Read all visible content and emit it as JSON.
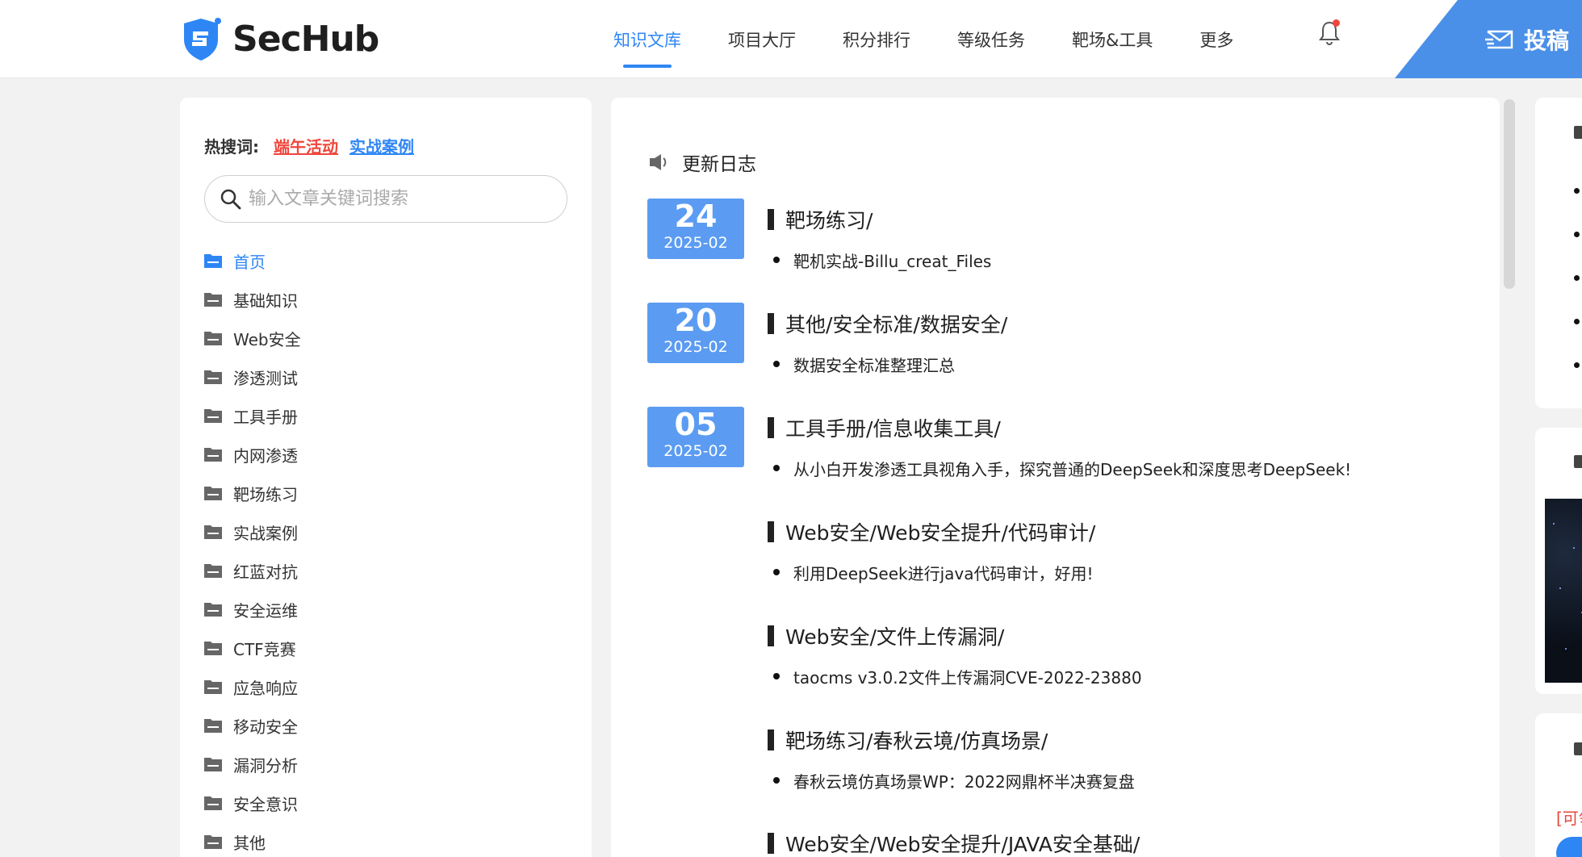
{
  "header": {
    "logo_text": "SecHub",
    "nav": [
      {
        "label": "知识文库",
        "active": true
      },
      {
        "label": "项目大厅",
        "active": false
      },
      {
        "label": "积分排行",
        "active": false
      },
      {
        "label": "等级任务",
        "active": false
      },
      {
        "label": "靶场&工具",
        "active": false
      },
      {
        "label": "更多",
        "active": false
      }
    ],
    "submit_label": "投稿"
  },
  "sidebar": {
    "hot_label": "热搜词:",
    "hot_words": [
      "端午活动",
      "实战案例"
    ],
    "search_placeholder": "输入文章关键词搜索",
    "categories": [
      {
        "label": "首页",
        "active": true
      },
      {
        "label": "基础知识"
      },
      {
        "label": "Web安全"
      },
      {
        "label": "渗透测试"
      },
      {
        "label": "工具手册"
      },
      {
        "label": "内网渗透"
      },
      {
        "label": "靶场练习"
      },
      {
        "label": "实战案例"
      },
      {
        "label": "红蓝对抗"
      },
      {
        "label": "安全运维"
      },
      {
        "label": "CTF竞赛"
      },
      {
        "label": "应急响应"
      },
      {
        "label": "移动安全"
      },
      {
        "label": "漏洞分析"
      },
      {
        "label": "安全意识"
      },
      {
        "label": "其他"
      }
    ]
  },
  "main": {
    "title": "更新日志",
    "badges": [
      {
        "day": "24",
        "ym": "2025-02"
      },
      {
        "day": "20",
        "ym": "2025-02"
      },
      {
        "day": "05",
        "ym": "2025-02"
      }
    ],
    "entries": [
      {
        "path": "靶场练习/",
        "item": "靶机实战-Billu_creat_Files"
      },
      {
        "path": "其他/安全标准/数据安全/",
        "item": "数据安全标准整理汇总"
      },
      {
        "path": "工具手册/信息收集工具/",
        "item": "从小白开发渗透工具视角入手，探究普通的DeepSeek和深度思考DeepSeek!"
      },
      {
        "path": "Web安全/Web安全提升/代码审计/",
        "item": "利用DeepSeek进行java代码审计，好用!"
      },
      {
        "path": "Web安全/文件上传漏洞/",
        "item": "taocms v3.0.2文件上传漏洞CVE-2022-23880"
      },
      {
        "path": "靶场练习/春秋云境/仿真场景/",
        "item": "春秋云境仿真场景WP：2022网鼎杯半决赛复盘"
      },
      {
        "path": "Web安全/Web安全提升/JAVA安全基础/",
        "item": ""
      }
    ]
  },
  "right": {
    "red_text": "[可领"
  },
  "colors": {
    "accent": "#2e86f5",
    "badge": "#5b9cf2",
    "hot_red": "#f0463c",
    "submit_bg": "#4a90e8"
  }
}
